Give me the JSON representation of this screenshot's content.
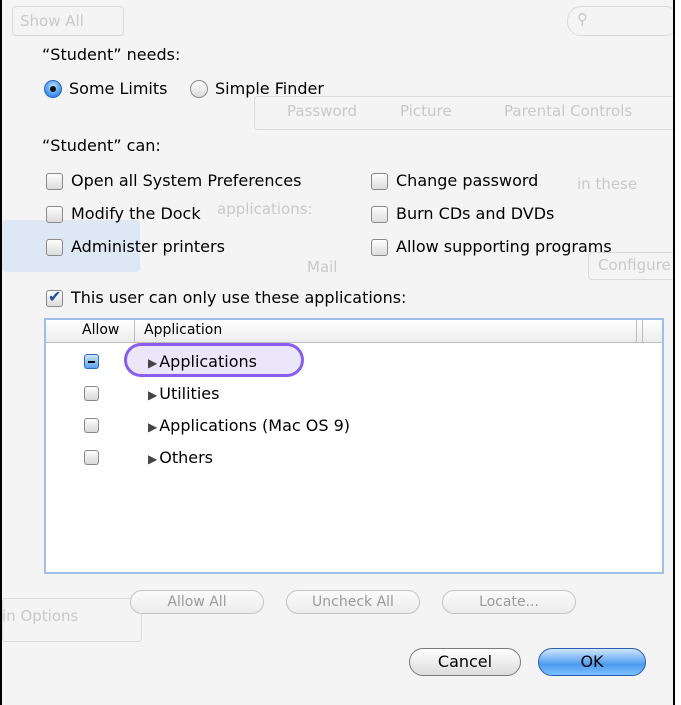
{
  "background_ghost": {
    "show_all": "Show All",
    "tabs": [
      "Password",
      "Picture",
      "Parental Controls"
    ],
    "mail": "Mail",
    "applications_frag": "applications:",
    "in_these": "in these",
    "options": "in Options",
    "config": "Configure"
  },
  "sheet": {
    "needs_label": "“Student” needs:",
    "mode_options": [
      {
        "label": "Some Limits",
        "selected": true
      },
      {
        "label": "Simple Finder",
        "selected": false
      }
    ],
    "can_label": "“Student” can:",
    "permissions_left": [
      {
        "label": "Open all System Preferences",
        "checked": false
      },
      {
        "label": "Modify the Dock",
        "checked": false
      },
      {
        "label": "Administer printers",
        "checked": false
      }
    ],
    "permissions_right": [
      {
        "label": "Change password",
        "checked": false
      },
      {
        "label": "Burn CDs and DVDs",
        "checked": false
      },
      {
        "label": "Allow supporting programs",
        "checked": false
      }
    ],
    "only_apps": {
      "label": "This user can only use these applications:",
      "checked": true
    }
  },
  "table": {
    "col_allow": "Allow",
    "col_app": "Application",
    "rows": [
      {
        "label": "Applications",
        "state": "mixed",
        "highlighted": true
      },
      {
        "label": "Utilities",
        "state": "unchecked",
        "highlighted": false
      },
      {
        "label": "Applications (Mac OS 9)",
        "state": "unchecked",
        "highlighted": false
      },
      {
        "label": "Others",
        "state": "unchecked",
        "highlighted": false
      }
    ],
    "highlight_color": "#8a5cf0"
  },
  "buttons": {
    "allow_all": "Allow All",
    "uncheck_all": "Uncheck All",
    "locate": "Locate...",
    "cancel": "Cancel",
    "ok": "OK"
  },
  "colors": {
    "accent": "#4d9bf0",
    "highlight_border": "#8a5cf0"
  }
}
